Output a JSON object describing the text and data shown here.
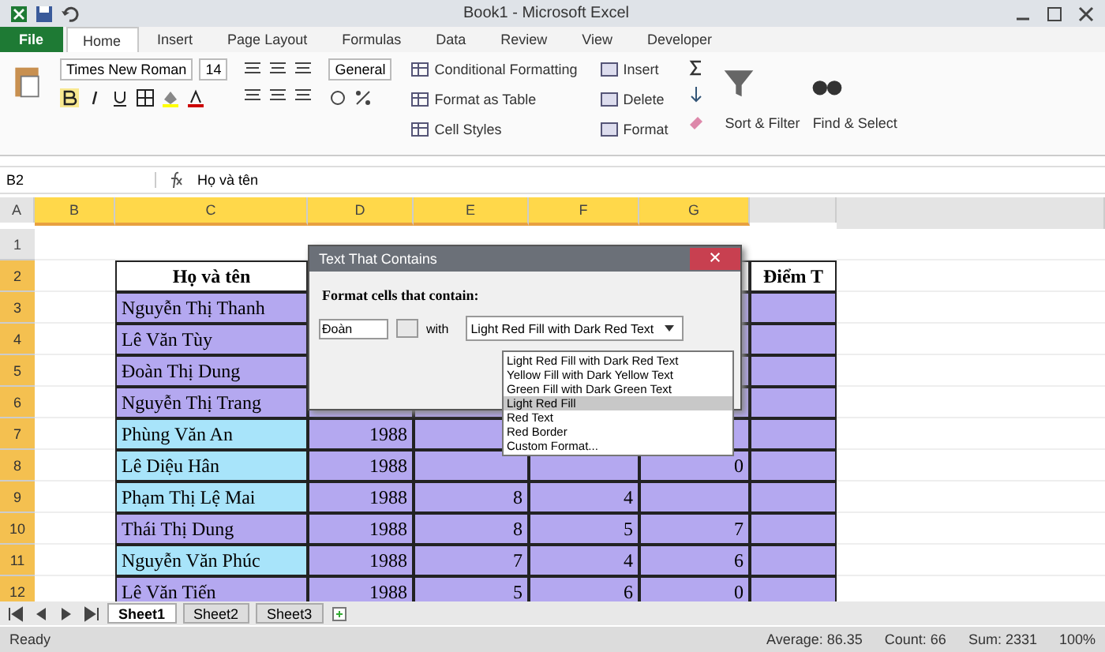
{
  "window": {
    "title": "Book1 - Microsoft Excel"
  },
  "ribbon_tabs": [
    {
      "label": "File",
      "kind": "file",
      "selected": false
    },
    {
      "label": "Home",
      "kind": "tab",
      "selected": true
    },
    {
      "label": "Insert",
      "kind": "tab",
      "selected": false
    },
    {
      "label": "Page Layout",
      "kind": "tab",
      "selected": false
    },
    {
      "label": "Formulas",
      "kind": "tab",
      "selected": false
    },
    {
      "label": "Data",
      "kind": "tab",
      "selected": false
    },
    {
      "label": "Review",
      "kind": "tab",
      "selected": false
    },
    {
      "label": "View",
      "kind": "tab",
      "selected": false
    },
    {
      "label": "Developer",
      "kind": "tab",
      "selected": false
    }
  ],
  "ribbon": {
    "font_name": "Times New Roman",
    "font_size": "14",
    "number_format": "General",
    "styles": [
      "Conditional Formatting",
      "Format as Table",
      "Cell Styles"
    ],
    "cells": [
      "Insert",
      "Delete",
      "Format"
    ],
    "editing": [
      "Sort & Filter",
      "Find & Select"
    ]
  },
  "formula_bar": {
    "name_box": "B2",
    "value": "Họ và tên"
  },
  "columns": [
    {
      "label": "A",
      "selected": false
    },
    {
      "label": "B",
      "selected": true
    },
    {
      "label": "C",
      "selected": true
    },
    {
      "label": "D",
      "selected": true
    },
    {
      "label": "E",
      "selected": true
    },
    {
      "label": "F",
      "selected": true
    },
    {
      "label": "G",
      "selected": true
    }
  ],
  "rows": [
    {
      "number": "1",
      "selected": false,
      "kind": "blank",
      "cells": []
    },
    {
      "number": "2",
      "selected": true,
      "kind": "header",
      "cells": [
        "Họ và tên",
        null,
        null,
        null,
        null,
        "Điểm T"
      ]
    },
    {
      "number": "3",
      "selected": true,
      "kind": "data",
      "color": "#b4a8f0",
      "cells": [
        "Nguyễn Thị Thanh",
        null,
        null,
        null,
        null,
        null
      ]
    },
    {
      "number": "4",
      "selected": true,
      "kind": "data",
      "color": "#b4a8f0",
      "cells": [
        "Lê Văn Tùy",
        null,
        null,
        null,
        null,
        null
      ]
    },
    {
      "number": "5",
      "selected": true,
      "kind": "data",
      "color": "#b4a8f0",
      "cells": [
        "Đoàn Thị Dung",
        null,
        null,
        null,
        null,
        null
      ]
    },
    {
      "number": "6",
      "selected": true,
      "kind": "data",
      "color": "#b4a8f0",
      "cells": [
        "Nguyễn Thị Trang",
        null,
        null,
        null,
        null,
        null
      ]
    },
    {
      "number": "7",
      "selected": true,
      "kind": "data",
      "color": "#a8e4fa",
      "cells": [
        "Phùng Văn An",
        "1988",
        null,
        null,
        null,
        null
      ]
    },
    {
      "number": "8",
      "selected": true,
      "kind": "data",
      "color": "#a8e4fa",
      "cells": [
        "Lê Diệu Hân",
        "1988",
        null,
        null,
        "0",
        null
      ]
    },
    {
      "number": "9",
      "selected": true,
      "kind": "data",
      "color": "#a8e4fa",
      "cells": [
        "Phạm Thị Lệ Mai",
        "1988",
        "8",
        "4",
        null,
        null
      ]
    },
    {
      "number": "10",
      "selected": true,
      "kind": "data",
      "color": "#b4a8f0",
      "cells": [
        "Thái Thị Dung",
        "1988",
        "8",
        "5",
        "7",
        null
      ]
    },
    {
      "number": "11",
      "selected": true,
      "kind": "data",
      "color": "#a8e4fa",
      "cells": [
        "Nguyễn Văn Phúc",
        "1988",
        "7",
        "4",
        "6",
        null
      ]
    },
    {
      "number": "12",
      "selected": true,
      "kind": "data",
      "color": "#b4a8f0",
      "cells": [
        "Lê Văn Tiến",
        "1988",
        "5",
        "6",
        "0",
        null
      ]
    }
  ],
  "dialog": {
    "title": "Text That Contains",
    "prompt": "Format cells that contain:",
    "value": "Đoàn",
    "with_label": "with",
    "format": "Light Red Fill with Dark Red Text",
    "options": [
      {
        "label": "Light Red Fill with Dark Red Text",
        "selected": false
      },
      {
        "label": "Yellow Fill with Dark Yellow Text",
        "selected": false
      },
      {
        "label": "Green Fill with Dark Green Text",
        "selected": false
      },
      {
        "label": "Light Red Fill",
        "selected": true
      },
      {
        "label": "Red Text",
        "selected": false
      },
      {
        "label": "Red Border",
        "selected": false
      },
      {
        "label": "Custom Format...",
        "selected": false
      }
    ]
  },
  "sheet_tabs": [
    {
      "label": "Sheet1",
      "selected": true
    },
    {
      "label": "Sheet2",
      "selected": false
    },
    {
      "label": "Sheet3",
      "selected": false
    }
  ],
  "status_bar": {
    "mode": "Ready",
    "average": "Average: 86.35",
    "count": "Count: 66",
    "sum": "Sum: 2331",
    "zoom": "100%"
  }
}
